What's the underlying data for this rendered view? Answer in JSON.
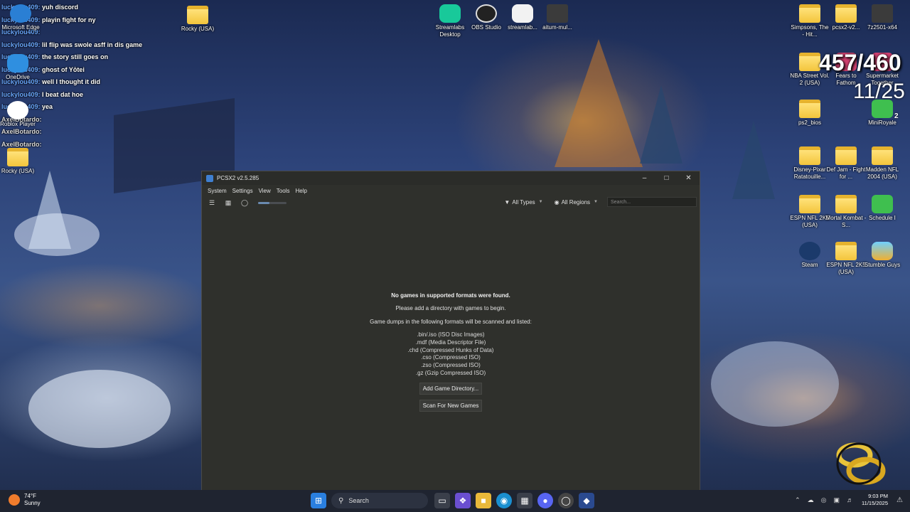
{
  "chat": [
    {
      "user": "luckylou409:",
      "msg": "yuh discord",
      "type": "lucky"
    },
    {
      "user": "luckylou409:",
      "msg": "playin fight for ny",
      "type": "lucky"
    },
    {
      "user": "luckylou409:",
      "msg": "",
      "type": "lucky"
    },
    {
      "user": "luckylou409:",
      "msg": "lil flip was swole asff in dis game",
      "type": "lucky"
    },
    {
      "user": "luckylou409:",
      "msg": "the story still goes on",
      "type": "lucky"
    },
    {
      "user": "luckylou409:",
      "msg": "ghost of Yōtei",
      "type": "lucky"
    },
    {
      "user": "luckylou409:",
      "msg": "well I thought it did",
      "type": "lucky"
    },
    {
      "user": "luckylou409:",
      "msg": "I beat dat hoe",
      "type": "lucky"
    },
    {
      "user": "luckylou409:",
      "msg": "yea",
      "type": "lucky"
    },
    {
      "user": "AxelBotardo:",
      "msg": "",
      "type": "axel"
    },
    {
      "user": "AxelBotardo:",
      "msg": "",
      "type": "axel"
    },
    {
      "user": "AxelBotardo:",
      "msg": "",
      "type": "axel"
    }
  ],
  "desktop_left": [
    {
      "label": "Microsoft Edge"
    },
    {
      "label": "OneDrive"
    },
    {
      "label": "Roblox Player"
    },
    {
      "label": "Rocky (USA)"
    }
  ],
  "desktop_top": [
    {
      "label": "Rocky (USA)"
    },
    {
      "label": "Streamlabs Desktop"
    },
    {
      "label": "OBS Studio"
    },
    {
      "label": "streamlab..."
    },
    {
      "label": "aitum-mul..."
    }
  ],
  "desktop_right": [
    {
      "label": "Simpsons, The - Hit..."
    },
    {
      "label": "pcsx2-v2..."
    },
    {
      "label": "7z2501-x64"
    },
    {
      "label": "NBA Street Vol. 2 (USA)"
    },
    {
      "label": "Fears to Fathom"
    },
    {
      "label": "Supermarket Together"
    },
    {
      "label": "ps2_bios"
    },
    {
      "label": "MiniRoyale"
    },
    {
      "label": "Disney-Pixar Ratatouille..."
    },
    {
      "label": "Def Jam - Fight for ..."
    },
    {
      "label": "Madden NFL 2004 (USA)"
    },
    {
      "label": "ESPN NFL 2K5 (USA)"
    },
    {
      "label": "Mortal Kombat - S..."
    },
    {
      "label": "Schedule I"
    },
    {
      "label": "Steam"
    },
    {
      "label": "ESPN NFL 2K5 (USA)"
    },
    {
      "label": "Stumble Guys"
    }
  ],
  "overlay": {
    "counter_big": "457/460",
    "counter_small": "11/25",
    "badge": "2"
  },
  "window": {
    "title": "PCSX2 v2.5.285",
    "menu": [
      "System",
      "Settings",
      "View",
      "Tools",
      "Help"
    ],
    "filters": {
      "types": "All Types",
      "regions": "All Regions"
    },
    "search_placeholder": "Search...",
    "zoom_level": 0.4,
    "empty": {
      "heading": "No games in supported formats were found.",
      "sub": "Please add a directory with games to begin.",
      "info": "Game dumps in the following formats will be scanned and listed:",
      "formats": [
        ".bin/.iso (ISO Disc Images)",
        ".mdf (Media Descriptor File)",
        ".chd (Compressed Hunks of Data)",
        ".cso (Compressed ISO)",
        ".zso (Compressed ISO)",
        ".gz (Gzip Compressed ISO)"
      ],
      "add_button": "Add Game Directory...",
      "scan_button": "Scan For New Games"
    }
  },
  "taskbar": {
    "weather_temp": "74°F",
    "weather_desc": "Sunny",
    "search_label": "Search",
    "time": "9:03 PM",
    "date": "11/15/2025"
  },
  "colors": {
    "chat_user": "#6aa8ff",
    "window_bg": "#2f302c",
    "taskbar_bg": "#1f2430"
  }
}
